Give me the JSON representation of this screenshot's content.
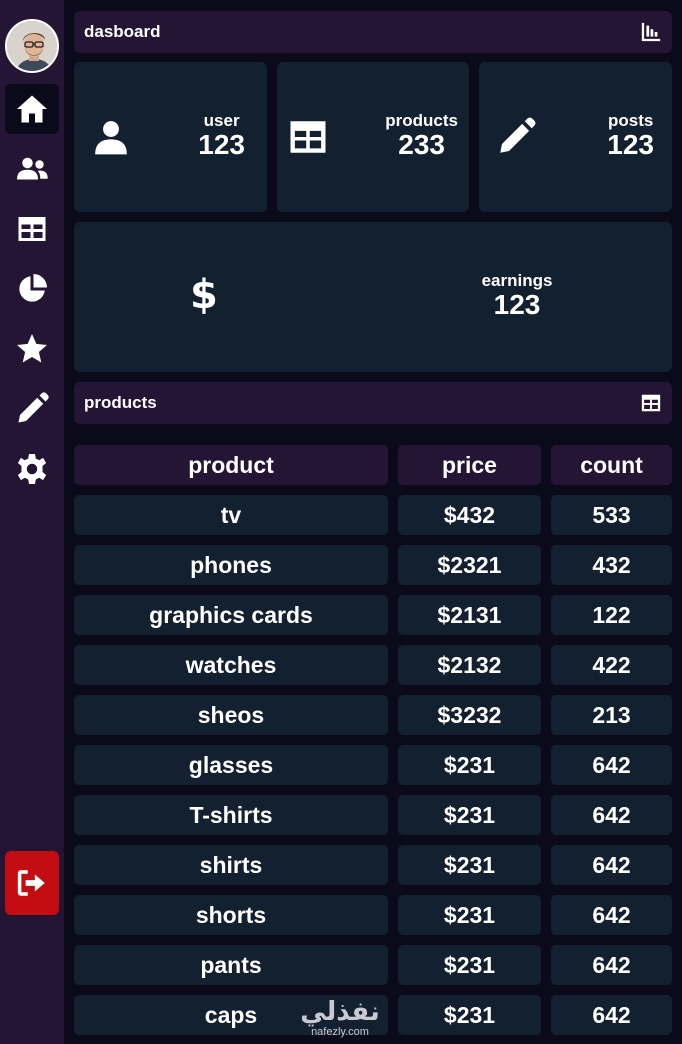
{
  "sidebar": {
    "nav": [
      {
        "icon": "home-icon",
        "active": true
      },
      {
        "icon": "users-icon",
        "active": false
      },
      {
        "icon": "table-icon",
        "active": false
      },
      {
        "icon": "pie-chart-icon",
        "active": false
      },
      {
        "icon": "star-icon",
        "active": false
      },
      {
        "icon": "pencil-icon",
        "active": false
      },
      {
        "icon": "gear-icon",
        "active": false
      }
    ],
    "logout_icon": "sign-out-icon"
  },
  "dashboard": {
    "title": "dasboard",
    "header_icon": "bar-chart-icon",
    "cards": [
      {
        "label": "user",
        "value": "123",
        "icon": "user-icon"
      },
      {
        "label": "products",
        "value": "233",
        "icon": "table-icon"
      },
      {
        "label": "posts",
        "value": "123",
        "icon": "pencil-icon"
      },
      {
        "label": "earnings",
        "value": "123",
        "icon": "dollar-icon"
      }
    ]
  },
  "products": {
    "title": "products",
    "header_icon": "table-icon",
    "columns": [
      "product",
      "price",
      "count"
    ],
    "rows": [
      [
        "tv",
        "$432",
        "533"
      ],
      [
        "phones",
        "$2321",
        "432"
      ],
      [
        "graphics cards",
        "$2131",
        "122"
      ],
      [
        "watches",
        "$2132",
        "422"
      ],
      [
        "sheos",
        "$3232",
        "213"
      ],
      [
        "glasses",
        "$231",
        "642"
      ],
      [
        "T-shirts",
        "$231",
        "642"
      ],
      [
        "shirts",
        "$231",
        "642"
      ],
      [
        "shorts",
        "$231",
        "642"
      ],
      [
        "pants",
        "$231",
        "642"
      ],
      [
        "caps",
        "$231",
        "642"
      ]
    ]
  },
  "watermark": {
    "arabic": "نفذلي",
    "latin": "nafezly.com"
  },
  "colors": {
    "background": "#0b0a1a",
    "sidebar": "#241534",
    "card": "#12202f",
    "logout": "#c40d12"
  }
}
